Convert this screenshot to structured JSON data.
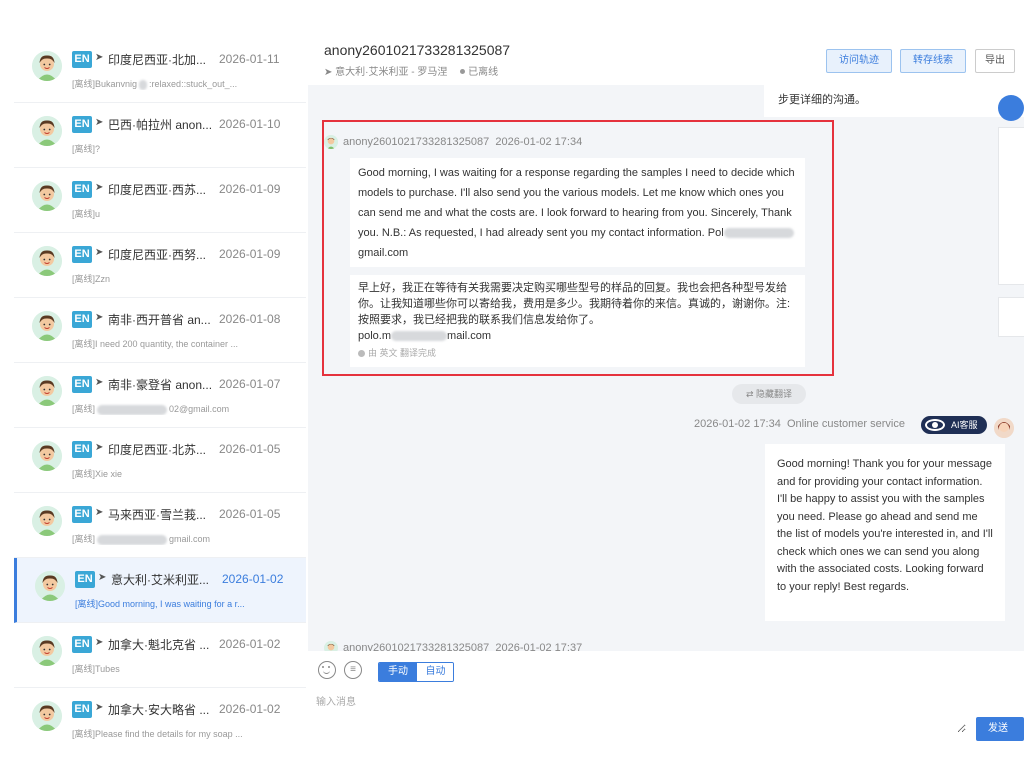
{
  "header": {
    "visitor_name": "anony2601021733281325087",
    "location": "意大利·艾米利亚 - 罗马涅",
    "status": "已离线",
    "buttons": {
      "visit_track": "访问轨迹",
      "save_lead": "转存线索",
      "export": "导出"
    }
  },
  "conversations": [
    {
      "lang": "EN",
      "name": "印度尼西亚·北加...",
      "date": "2026-01-11",
      "tag": "[离线]",
      "preview": "Bukanvnig",
      "preview_tail": ":relaxed::stuck_out_...",
      "active": false
    },
    {
      "lang": "EN",
      "name": "巴西·帕拉州 anon...",
      "date": "2026-01-10",
      "tag": "[离线]",
      "preview": "?",
      "active": false
    },
    {
      "lang": "EN",
      "name": "印度尼西亚·西苏...",
      "date": "2026-01-09",
      "tag": "[离线]",
      "preview": "u",
      "active": false
    },
    {
      "lang": "EN",
      "name": "印度尼西亚·西努...",
      "date": "2026-01-09",
      "tag": "[离线]",
      "preview": "Zzn",
      "active": false
    },
    {
      "lang": "EN",
      "name": "南非·西开普省 an...",
      "date": "2026-01-08",
      "tag": "[离线]",
      "preview": "I need 200 quantity, the container ...",
      "active": false
    },
    {
      "lang": "EN",
      "name": "南非·豪登省 anon...",
      "date": "2026-01-07",
      "tag": "[离线]",
      "preview": "",
      "preview_tail": "02@gmail.com",
      "active": false
    },
    {
      "lang": "EN",
      "name": "印度尼西亚·北苏...",
      "date": "2026-01-05",
      "tag": "[离线]",
      "preview": "Xie xie",
      "active": false
    },
    {
      "lang": "EN",
      "name": "马来西亚·雪兰莪...",
      "date": "2026-01-05",
      "tag": "[离线]",
      "preview": "",
      "preview_tail": "gmail.com",
      "active": false
    },
    {
      "lang": "EN",
      "name": "意大利·艾米利亚...",
      "date": "2026-01-02",
      "tag": "[离线]",
      "preview": "Good morning, I was waiting for a r...",
      "active": true
    },
    {
      "lang": "EN",
      "name": "加拿大·魁北克省 ...",
      "date": "2026-01-02",
      "tag": "[离线]",
      "preview": "Tubes",
      "active": false
    },
    {
      "lang": "EN",
      "name": "加拿大·安大略省 ...",
      "date": "2026-01-02",
      "tag": "[离线]",
      "preview": "Please find the details for my soap ...",
      "active": false
    }
  ],
  "chat": {
    "top_bubble": "步更详细的沟通。",
    "msg1": {
      "sender": "anony2601021733281325087",
      "time": "2026-01-02 17:34",
      "text": "Good morning, I was waiting for a response regarding the samples I need to decide which models to purchase. I'll also send you the various models. Let me know which ones you can send me and what the costs are. I look forward to hearing from you. Sincerely,  Thank you.  N.B.: As requested, I had already sent you my contact information.  Pol",
      "text_tail": "gmail.com",
      "translation": "早上好，我正在等待有关我需要决定购买哪些型号的样品的回复。我也会把各种型号发给你。让我知道哪些你可以寄给我，费用是多少。我期待着你的来信。真诚的，谢谢你。注: 按照要求，我已经把我的联系我们信息发给你了。",
      "translation_tail_start": "polo.m",
      "translation_tail_end": "mail.com",
      "translation_note": "由 英文 翻译完成"
    },
    "recall_label": "隐藏翻译",
    "agent": {
      "time": "2026-01-02 17:34",
      "name": "Online customer service",
      "badge": "AI客服",
      "text": "Good morning! Thank you for your message and for providing your contact information. I'll be happy to assist you with the samples you need. Please go ahead and send me the list of models you're interested in, and I'll check which ones we can send you along with the associated costs. Looking forward to your reply! Best regards."
    },
    "msg2": {
      "sender": "anony2601021733281325087",
      "time": "2026-01-02 17:37"
    }
  },
  "input": {
    "mode_manual": "手动",
    "mode_auto": "自动",
    "placeholder": "输入消息",
    "send_label": "发送"
  },
  "colors": {
    "accent": "#3b7ddd",
    "highlight": "#e5323d",
    "badge": "#3aa7d6"
  }
}
